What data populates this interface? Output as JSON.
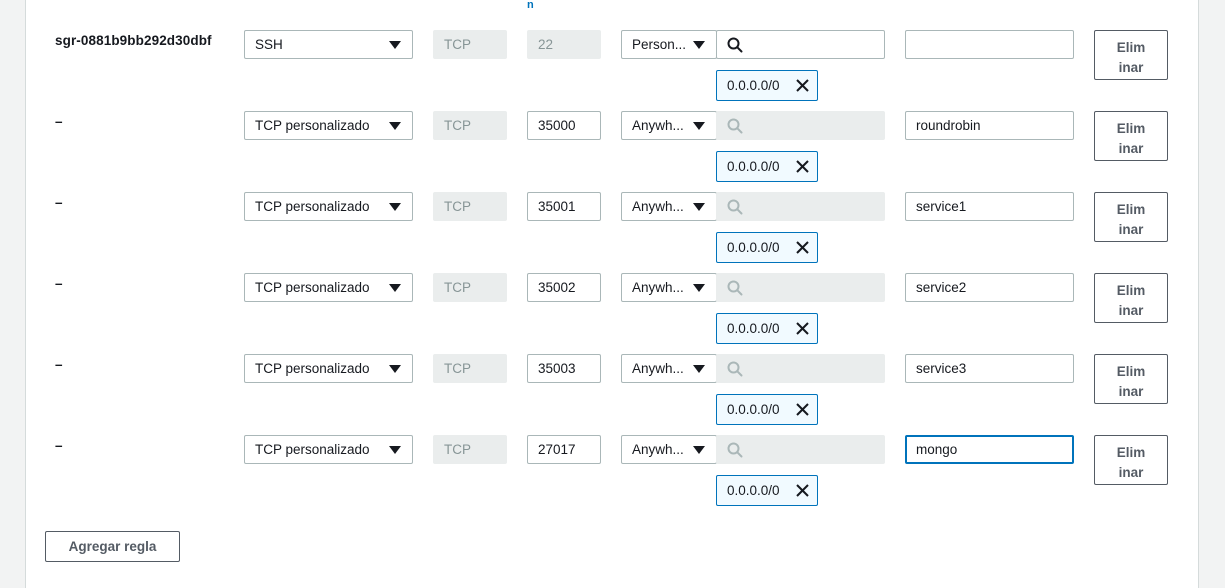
{
  "column_marker": "n",
  "rules": [
    {
      "id": "sgr-0881b9bb292d30dbf",
      "type": "SSH",
      "protocol": "TCP",
      "port": "22",
      "port_editable": false,
      "source": "Person...",
      "source_search_enabled": true,
      "cidr": "0.0.0.0/0",
      "description": "",
      "delete_line1": "Elim",
      "delete_line2": "inar"
    },
    {
      "id": "–",
      "type": "TCP personalizado",
      "protocol": "TCP",
      "port": "35000",
      "port_editable": true,
      "source": "Anywh...",
      "source_search_enabled": false,
      "cidr": "0.0.0.0/0",
      "description": "roundrobin",
      "delete_line1": "Elim",
      "delete_line2": "inar"
    },
    {
      "id": "–",
      "type": "TCP personalizado",
      "protocol": "TCP",
      "port": "35001",
      "port_editable": true,
      "source": "Anywh...",
      "source_search_enabled": false,
      "cidr": "0.0.0.0/0",
      "description": "service1",
      "delete_line1": "Elim",
      "delete_line2": "inar"
    },
    {
      "id": "–",
      "type": "TCP personalizado",
      "protocol": "TCP",
      "port": "35002",
      "port_editable": true,
      "source": "Anywh...",
      "source_search_enabled": false,
      "cidr": "0.0.0.0/0",
      "description": "service2",
      "delete_line1": "Elim",
      "delete_line2": "inar"
    },
    {
      "id": "–",
      "type": "TCP personalizado",
      "protocol": "TCP",
      "port": "35003",
      "port_editable": true,
      "source": "Anywh...",
      "source_search_enabled": false,
      "cidr": "0.0.0.0/0",
      "description": "service3",
      "delete_line1": "Elim",
      "delete_line2": "inar"
    },
    {
      "id": "–",
      "type": "TCP personalizado",
      "protocol": "TCP",
      "port": "27017",
      "port_editable": true,
      "source": "Anywh...",
      "source_search_enabled": false,
      "cidr": "0.0.0.0/0",
      "description": "mongo",
      "description_focused": true,
      "delete_line1": "Elim",
      "delete_line2": "inar"
    }
  ],
  "add_rule_label": "Agregar regla",
  "icons": {
    "search": "search-icon",
    "close": "close-icon",
    "dropdown": "caret-down-icon"
  },
  "colors": {
    "accent": "#0073bb",
    "border": "#aab7b8",
    "disabled_bg": "#eaeded",
    "button_text": "#545b64"
  }
}
